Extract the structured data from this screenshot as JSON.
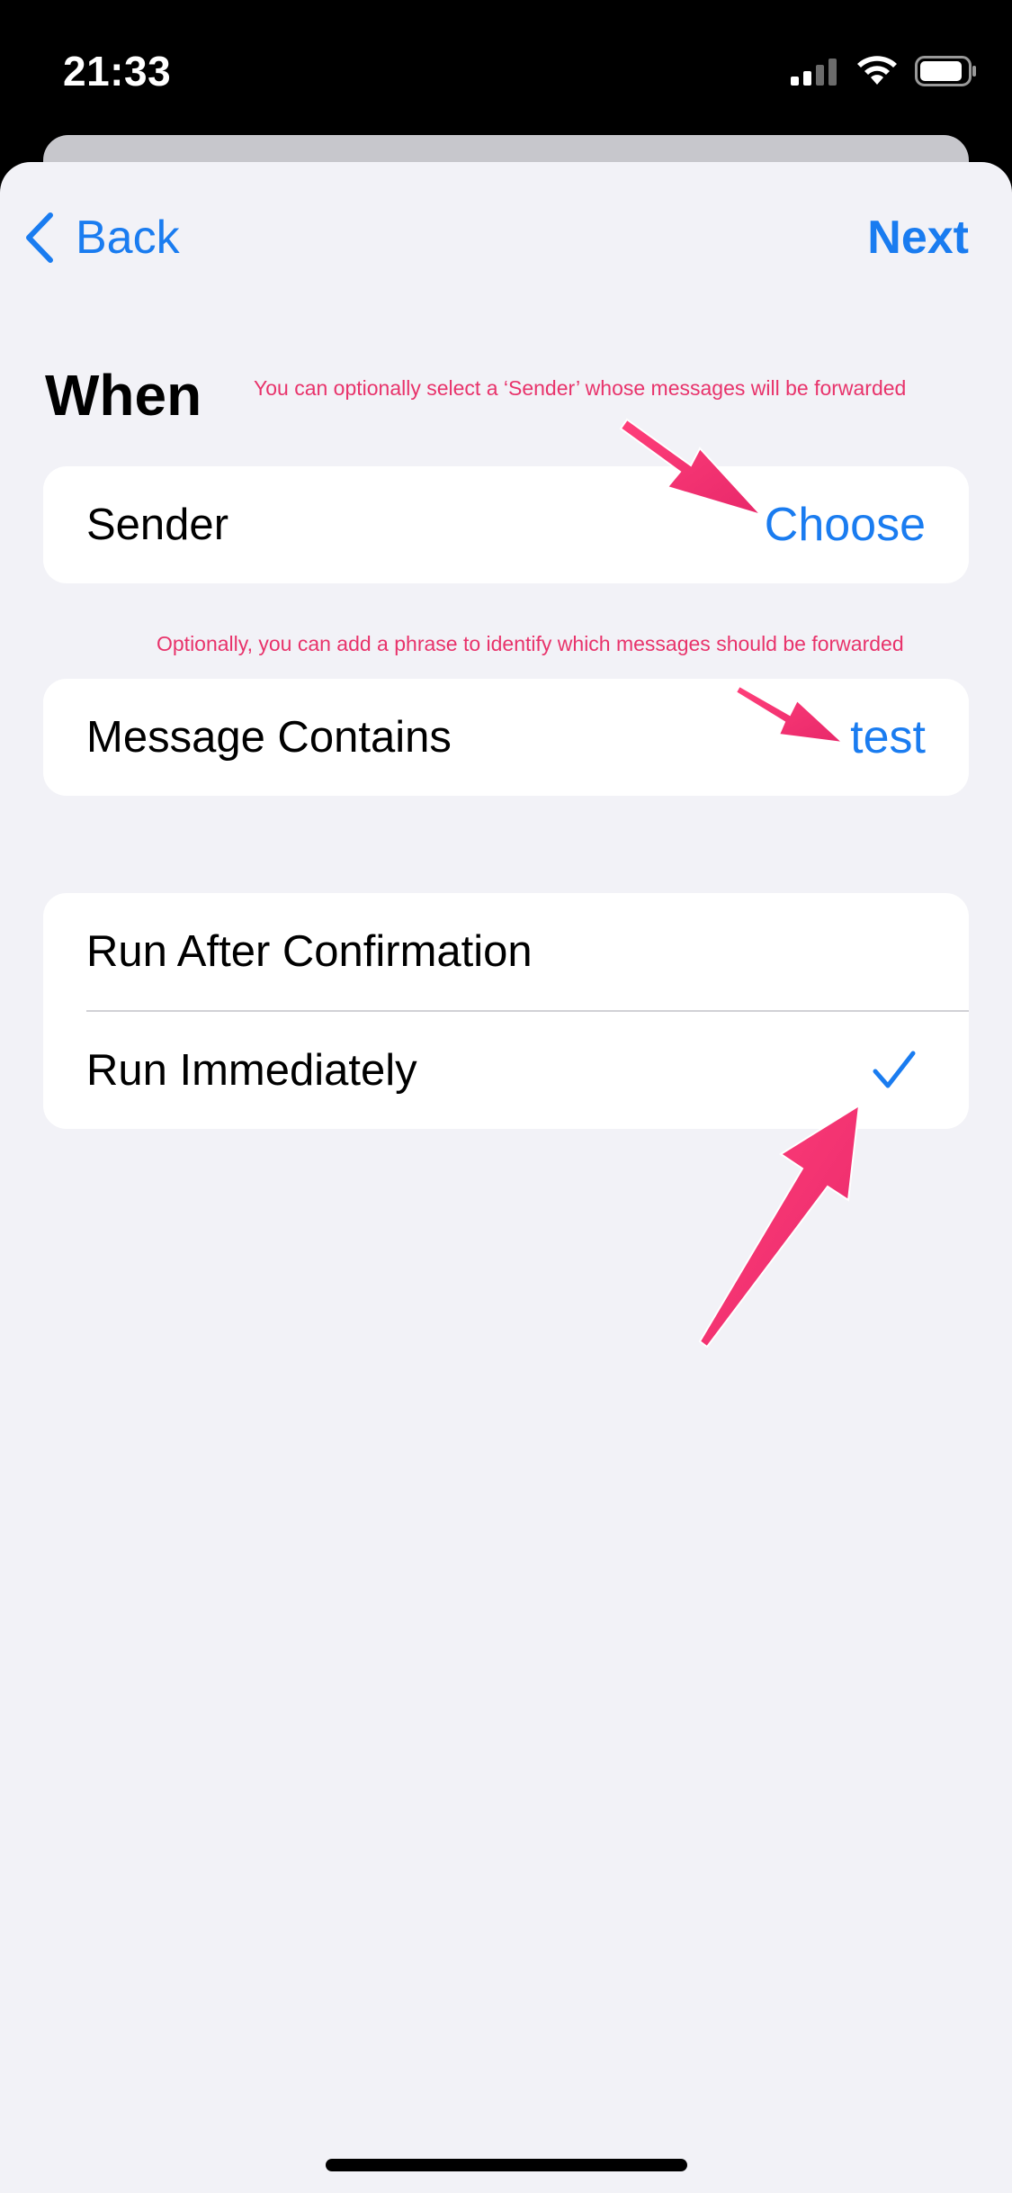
{
  "status_bar": {
    "time": "21:33",
    "icons": [
      "cellular-signal-icon",
      "wifi-icon",
      "battery-icon"
    ]
  },
  "nav": {
    "back_label": "Back",
    "next_label": "Next"
  },
  "section": {
    "title": "When"
  },
  "annotations": {
    "sender_hint": "You can optionally select a ‘Sender’ whose messages will be forwarded",
    "message_hint": "Optionally, you can add a phrase to identify which messages should be forwarded"
  },
  "sender_row": {
    "label": "Sender",
    "value": "Choose"
  },
  "message_row": {
    "label": "Message Contains",
    "value": "test"
  },
  "run_options": [
    {
      "label": "Run After Confirmation",
      "selected": false
    },
    {
      "label": "Run Immediately",
      "selected": true
    }
  ],
  "colors": {
    "accent": "#1a7cf0",
    "annotation": "#e8336b",
    "background": "#f2f2f7",
    "card": "#ffffff"
  }
}
